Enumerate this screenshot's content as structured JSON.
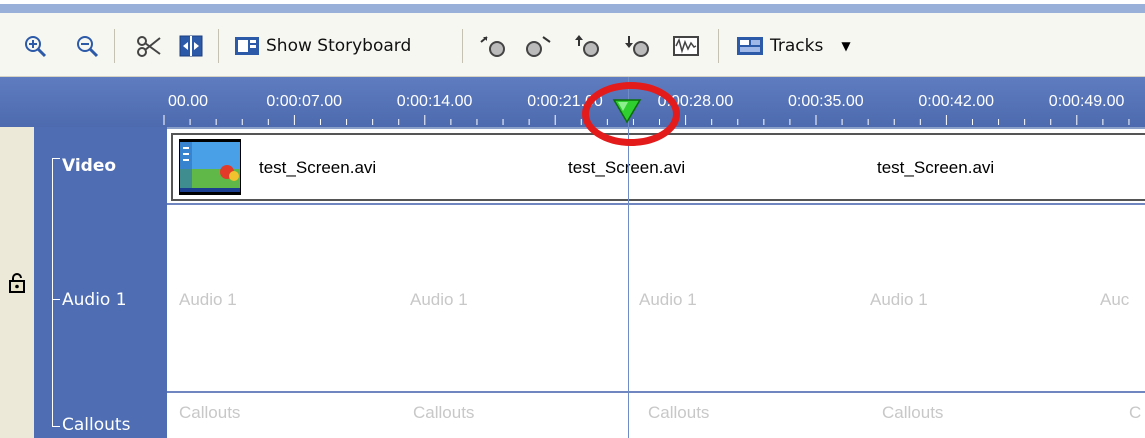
{
  "toolbar": {
    "zoom_in_icon": "zoom-in-icon",
    "zoom_out_icon": "zoom-out-icon",
    "cut_icon": "scissors-icon",
    "split_icon": "split-icon",
    "show_storyboard_label": "Show Storyboard",
    "tracks_label": "Tracks"
  },
  "ruler": {
    "ticks": [
      "00.00",
      "0:00:07.00",
      "0:00:14.00",
      "0:00:21.00",
      "0:00:28.00",
      "0:00:35.00",
      "0:00:42.00",
      "0:00:49.00"
    ]
  },
  "tracks": {
    "video": {
      "label": "Video",
      "clips": [
        "test_Screen.avi",
        "test_Screen.avi",
        "test_Screen.avi"
      ]
    },
    "audio": {
      "label": "Audio 1",
      "placeholders": [
        "Audio 1",
        "Audio 1",
        "Audio 1",
        "Audio 1",
        "Auc"
      ]
    },
    "callouts": {
      "label": "Callouts",
      "placeholders": [
        "Callouts",
        "Callouts",
        "Callouts",
        "Callouts",
        "C"
      ]
    }
  },
  "colors": {
    "ruler_bg": "#4d6aaf",
    "track_label_bg": "#4f6db3",
    "playhead_marker": "#29c429",
    "highlight": "#e31b1b"
  }
}
